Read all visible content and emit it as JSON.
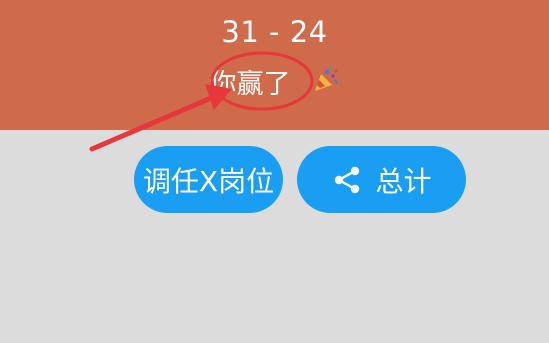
{
  "header": {
    "score": "31 - 24",
    "result": "你赢了",
    "background_color": "#cf6a4b"
  },
  "actions": {
    "transfer_label": "调任X岗位",
    "total_label": "总计",
    "button_color": "#1a9ef3"
  },
  "icons": {
    "celebration": "party-popper-icon",
    "share": "share-icon"
  },
  "annotation": {
    "color": "#e8373a"
  }
}
